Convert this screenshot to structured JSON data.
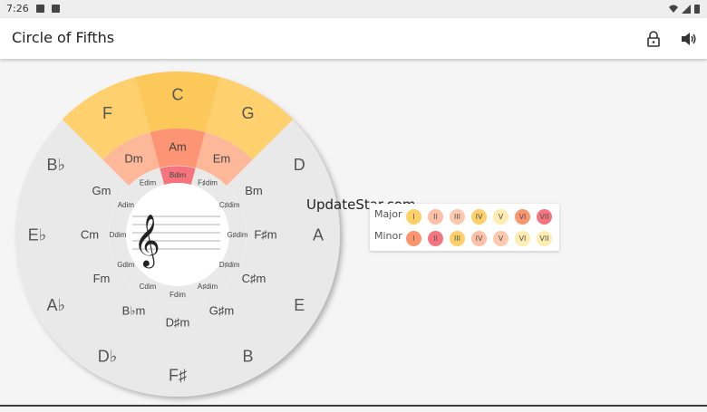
{
  "status": {
    "time": "7:26"
  },
  "appbar": {
    "title": "Circle of Fifths",
    "lock_icon": "lock-icon",
    "sound_icon": "volume-icon"
  },
  "wheel": {
    "major_keys": [
      "C",
      "G",
      "D",
      "A",
      "E",
      "B",
      "F♯",
      "D♭",
      "A♭",
      "E♭",
      "B♭",
      "F"
    ],
    "minor_keys": [
      "Am",
      "Em",
      "Bm",
      "F♯m",
      "C♯m",
      "G♯m",
      "D♯m",
      "B♭m",
      "Fm",
      "Cm",
      "Gm",
      "Dm"
    ],
    "dim_chords": [
      "Bdim",
      "F♯dim",
      "C♯dim",
      "G♯dim",
      "D♯dim",
      "A♯dim",
      "Fdim",
      "Cdim",
      "Gdim",
      "Ddim",
      "Adim",
      "Edim"
    ],
    "center_icon": "treble-clef-icon",
    "colors": {
      "major_highlight": "#fed16e",
      "tonic_highlight": "#fdc85a",
      "minor_highlight": "#fdb89a",
      "relative_minor": "#fd9575",
      "dim_highlight": "#f6747e",
      "outer": "#e9e9e9",
      "mid": "#efefef",
      "inner": "#f7f7f7"
    }
  },
  "scales": {
    "major": {
      "label": "Major",
      "degrees": [
        "I",
        "II",
        "III",
        "IV",
        "V",
        "VI",
        "VII"
      ],
      "colors": [
        "#fdd06a",
        "#fdc0a6",
        "#fdcab0",
        "#fdd06a",
        "#feedb0",
        "#fb9570",
        "#f6747e"
      ]
    },
    "minor": {
      "label": "Minor",
      "degrees": [
        "I",
        "II",
        "III",
        "IV",
        "V",
        "VI",
        "VII"
      ],
      "colors": [
        "#fb9570",
        "#f6747e",
        "#fdd06a",
        "#fdc0a6",
        "#fdcab0",
        "#feedb0",
        "#feedb0"
      ]
    }
  },
  "watermark": "UpdateStar.com"
}
